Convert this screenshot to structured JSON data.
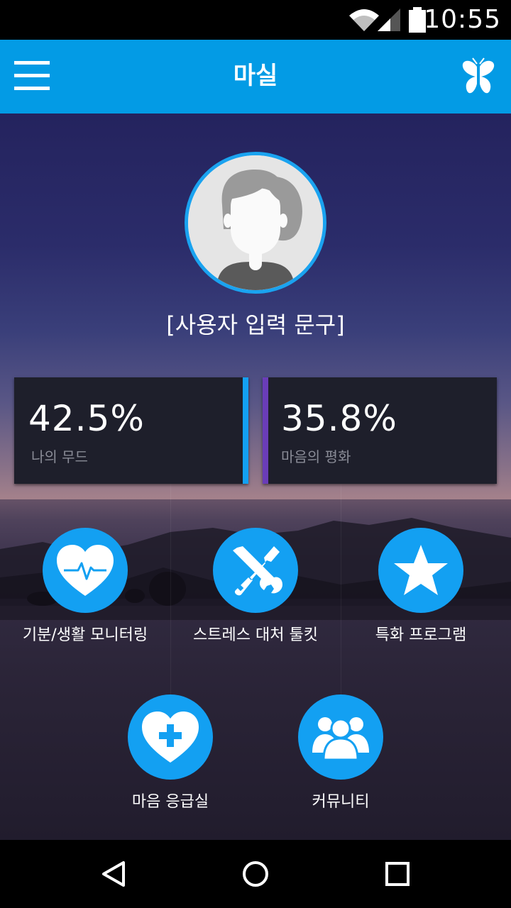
{
  "status_bar": {
    "time": "10:55",
    "icons": [
      "wifi-icon",
      "signal-icon",
      "battery-icon"
    ]
  },
  "app_bar": {
    "title": "마실",
    "menu_icon": "hamburger-menu-icon",
    "action_icon": "butterfly-icon",
    "color": "#039be5"
  },
  "profile": {
    "avatar_icon": "user-avatar-icon",
    "caption": "[사용자 입력 문구]"
  },
  "stats": [
    {
      "value": "42.5%",
      "label": "나의 무드",
      "accent_color": "#13a0f2"
    },
    {
      "value": "35.8%",
      "label": "마음의 평화",
      "accent_color": "#6a3db8"
    }
  ],
  "features": [
    {
      "label": "기분/생활 모니터링",
      "icon": "heart-pulse-icon"
    },
    {
      "label": "스트레스 대처 툴킷",
      "icon": "tools-icon"
    },
    {
      "label": "특화 프로그램",
      "icon": "star-icon"
    },
    {
      "label": "마음 응급실",
      "icon": "heart-plus-icon"
    },
    {
      "label": "커뮤니티",
      "icon": "community-icon"
    }
  ],
  "nav_bar": {
    "icons": [
      "back-icon",
      "home-icon",
      "recents-icon"
    ]
  },
  "colors": {
    "accent": "#13a0f2",
    "secondary_accent": "#6a3db8",
    "card_background": "#1e1f2b"
  }
}
